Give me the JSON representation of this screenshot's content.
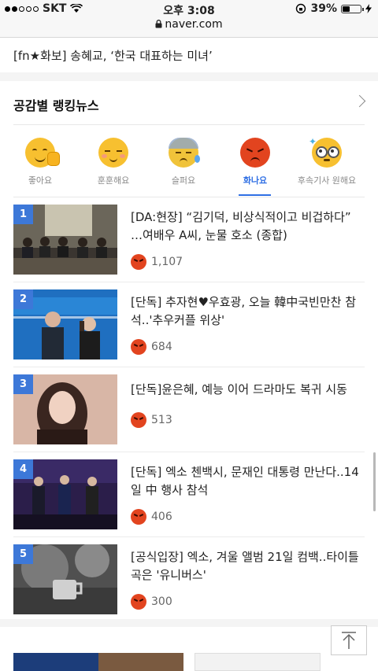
{
  "status_bar": {
    "carrier": "SKT",
    "time": "오후 3:08",
    "battery": "39%",
    "battery_level": 0.39,
    "url": "naver.com"
  },
  "headline_strip": {
    "text": "[fn★화보] 송혜교, ‘한국 대표하는 미녀’"
  },
  "ranking": {
    "title": "공감별 랭킹뉴스",
    "tabs": [
      {
        "label": "좋아요",
        "icon": "like-face-icon",
        "color": "#f7c030"
      },
      {
        "label": "훈훈해요",
        "icon": "warm-face-icon",
        "color": "#f7c030"
      },
      {
        "label": "슬퍼요",
        "icon": "sad-face-icon",
        "color": "#f0c33a"
      },
      {
        "label": "화나요",
        "icon": "angry-face-icon",
        "color": "#e2441f"
      },
      {
        "label": "후속기사 원해요",
        "icon": "want-more-face-icon",
        "color": "#f7c030"
      }
    ],
    "active_tab": "화나요",
    "items": [
      {
        "rank": "1",
        "title": "[DA:현장] “김기덕, 비상식적이고 비겁하다” …여배우 A씨, 눈물 호소 (종합)",
        "count": "1,107"
      },
      {
        "rank": "2",
        "title": "[단독] 추자현♥우효광, 오늘 韓中국빈만찬 참석..'추우커플 위상'",
        "count": "684"
      },
      {
        "rank": "3",
        "title": "[단독]윤은혜, 예능 이어 드라마도 복귀 시동",
        "count": "513"
      },
      {
        "rank": "4",
        "title": "[단독] 엑소 첸백시, 문재인 대통령 만난다..14일 中 행사 참석",
        "count": "406"
      },
      {
        "rank": "5",
        "title": "[공식입장] 엑소, 겨울 앨범 21일 컴백..타이틀곡은 '유니버스'",
        "count": "300"
      }
    ]
  },
  "colors": {
    "accent": "#2f6fe4",
    "rank_badge": "#3d78d8",
    "angry": "#e2441f"
  }
}
